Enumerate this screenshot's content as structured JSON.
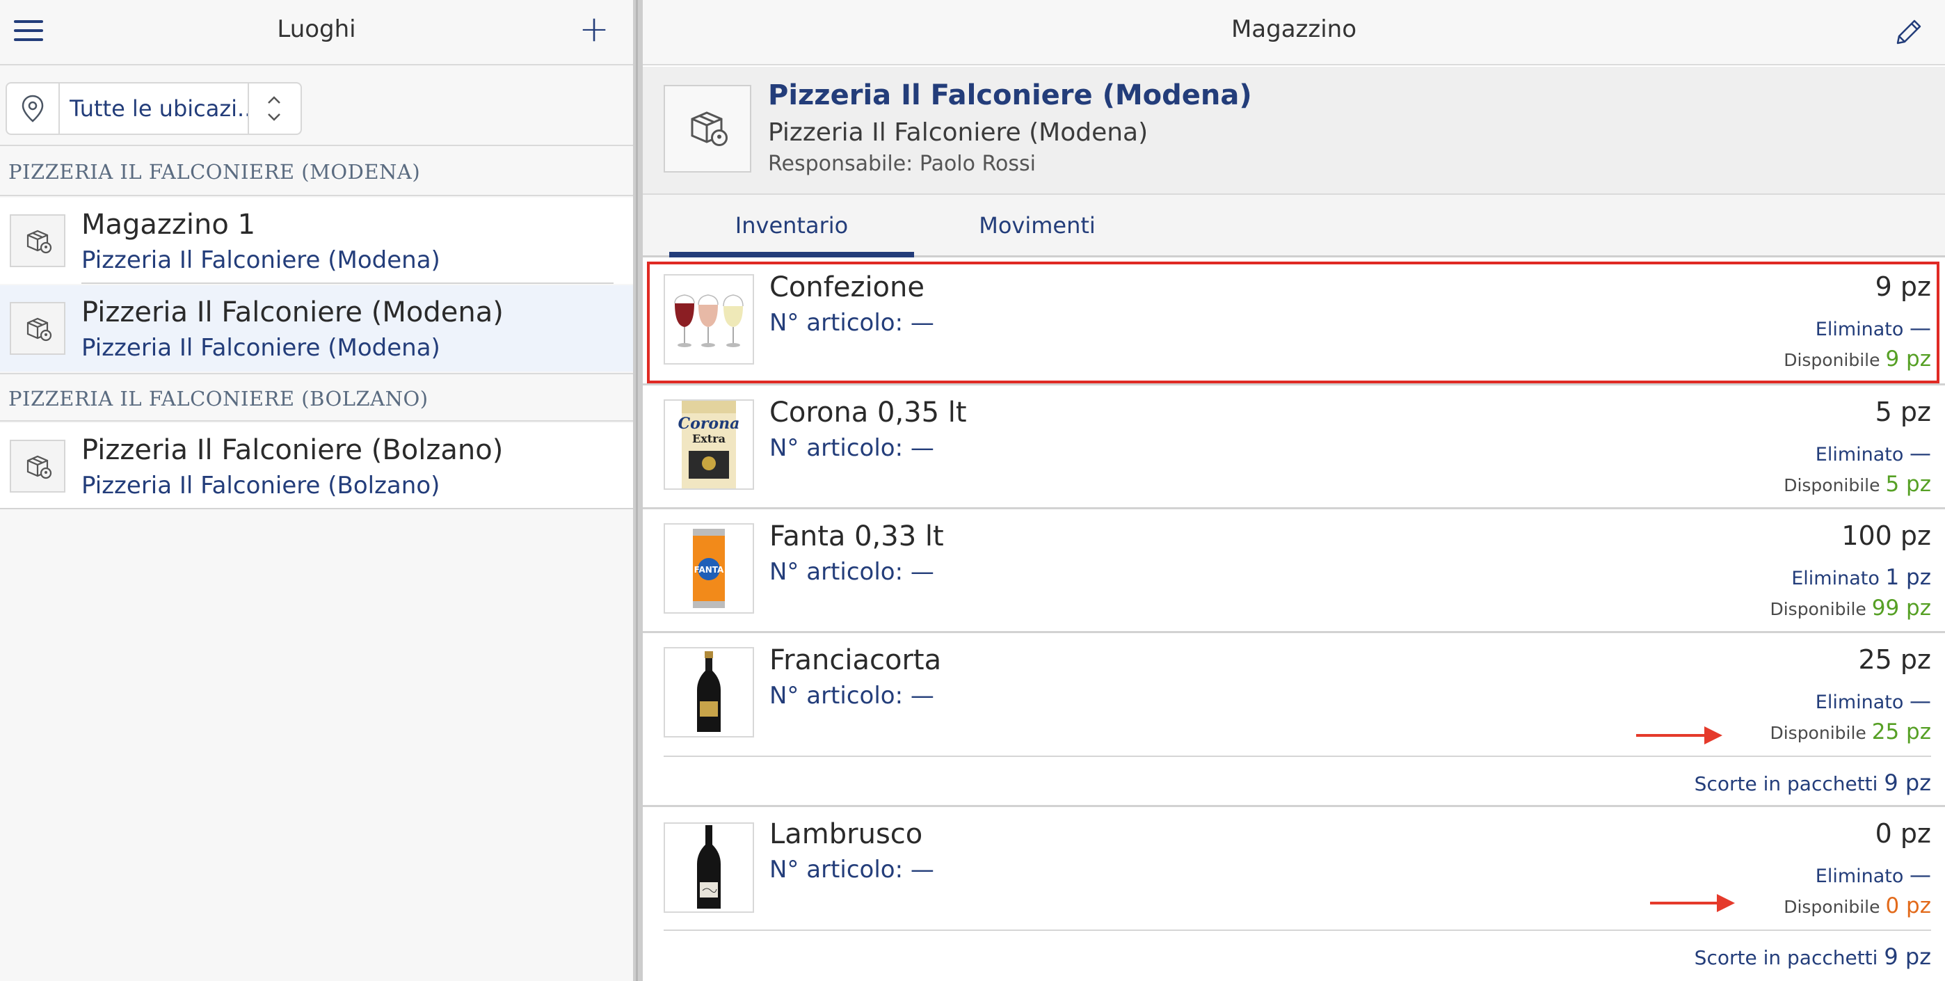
{
  "left": {
    "title": "Luoghi",
    "add_label": "+",
    "filter": {
      "value": "Tutte le ubicazi..."
    },
    "sections": [
      {
        "title": "PIZZERIA IL FALCONIERE (MODENA)",
        "items": [
          {
            "name": "Magazzino 1",
            "sub": "Pizzeria Il Falconiere (Modena)"
          },
          {
            "name": "Pizzeria Il Falconiere (Modena)",
            "sub": "Pizzeria Il Falconiere (Modena)"
          }
        ]
      },
      {
        "title": "PIZZERIA IL FALCONIERE (BOLZANO)",
        "items": [
          {
            "name": "Pizzeria Il Falconiere (Bolzano)",
            "sub": "Pizzeria Il Falconiere (Bolzano)"
          }
        ]
      }
    ]
  },
  "right": {
    "title": "Magazzino",
    "info": {
      "title": "Pizzeria Il Falconiere (Modena)",
      "subtitle": "Pizzeria Il Falconiere (Modena)",
      "responsabile": "Responsabile: Paolo Rossi"
    },
    "tabs": [
      {
        "label": "Inventario"
      },
      {
        "label": "Movimenti"
      }
    ],
    "labels": {
      "eliminato": "Eliminato",
      "disponibile": "Disponibile",
      "scorte": "Scorte in pacchetti"
    },
    "items": [
      {
        "name": "Confezione",
        "code": "N° articolo: —",
        "qty": "9 pz",
        "eliminato": "—",
        "disponibile": "9 pz"
      },
      {
        "name": "Corona 0,35 lt",
        "code": "N° articolo: —",
        "qty": "5 pz",
        "eliminato": "—",
        "disponibile": "5 pz"
      },
      {
        "name": "Fanta 0,33 lt",
        "code": "N° articolo: —",
        "qty": "100 pz",
        "eliminato": "1 pz",
        "disponibile": "99 pz"
      },
      {
        "name": "Franciacorta",
        "code": "N° articolo: —",
        "qty": "25 pz",
        "eliminato": "—",
        "disponibile": "25 pz",
        "scorte": "9 pz"
      },
      {
        "name": "Lambrusco",
        "code": "N° articolo: —",
        "qty": "0 pz",
        "eliminato": "—",
        "disponibile": "0 pz",
        "scorte": "9 pz"
      }
    ],
    "thumb_text": {
      "corona": "Corona",
      "corona_sub": "Extra",
      "fanta": "FANTA"
    }
  },
  "colors": {
    "accent": "#233d7a",
    "available": "#56a025",
    "zero": "#e26a1b",
    "annotation": "#e02a24"
  },
  "icons": [
    "menu-icon",
    "plus-icon",
    "location-pin-icon",
    "chevron-updown-icon",
    "warehouse-location-icon",
    "pencil-icon"
  ]
}
